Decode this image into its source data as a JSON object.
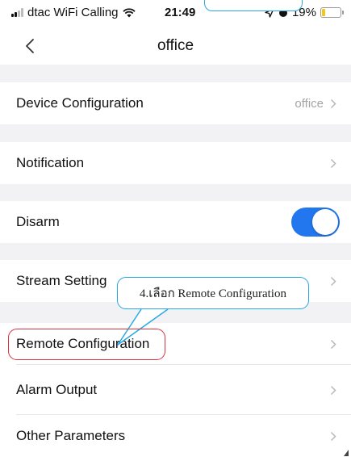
{
  "status_bar": {
    "carrier": "dtac WiFi Calling",
    "time": "21:49",
    "battery": "19%",
    "battery_level": 0.19,
    "icons": [
      "signal-icon",
      "wifi-icon",
      "location-arrow-icon",
      "alarm-icon",
      "battery-icon"
    ]
  },
  "nav": {
    "title": "office",
    "back_icon": "chevron-left-icon"
  },
  "settings": {
    "device_configuration": {
      "label": "Device Configuration",
      "value": "office"
    },
    "notification": {
      "label": "Notification"
    },
    "disarm": {
      "label": "Disarm",
      "enabled": true
    },
    "stream_setting": {
      "label": "Stream Setting"
    },
    "remote_configuration": {
      "label": "Remote Configuration"
    },
    "alarm_output": {
      "label": "Alarm Output"
    },
    "other_parameters": {
      "label": "Other Parameters"
    }
  },
  "annotation": {
    "callout_text": "4.เลือก Remote Configuration",
    "highlight_color": "#d9323b",
    "callout_color": "#2aa7e6"
  },
  "colors": {
    "accent": "#2277ee",
    "background": "#f2f2f4",
    "secondary_text": "#a4a4a8",
    "battery_low": "#f5c518"
  }
}
